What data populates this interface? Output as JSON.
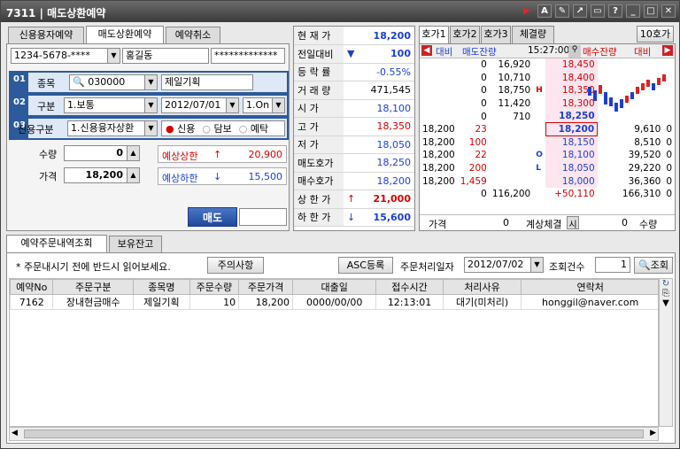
{
  "window": {
    "code": "7311",
    "title": "매도상환예약",
    "icons": [
      "play-icon",
      "a-icon",
      "edit-icon",
      "link-icon",
      "window-icon",
      "help-icon",
      "minimize-icon",
      "maximize-icon",
      "close-icon"
    ]
  },
  "tabs": [
    "신용용자예약",
    "매도상환예약",
    "예약취소"
  ],
  "account": {
    "number": "1234-5678-****",
    "name": "홍길동",
    "password": "*************"
  },
  "form": {
    "r1": {
      "num": "01",
      "label": "종목",
      "code": "030000",
      "name": "제일기획"
    },
    "r2": {
      "num": "02",
      "label": "구분",
      "type": "1.보통",
      "date": "2012/07/01",
      "option": "1.On"
    },
    "r3": {
      "num": "03",
      "label": "신용구분",
      "value": "1.신용융자상환",
      "radios": [
        "신용",
        "담보",
        "예탁"
      ]
    },
    "qty_label": "수량",
    "qty": "0",
    "price_label": "가격",
    "price": "18,200",
    "upper_label": "예상상한",
    "upper_arrow": "↑",
    "upper": "20,900",
    "lower_label": "예상하한",
    "lower_arrow": "↓",
    "lower": "15,500",
    "submit": "매도"
  },
  "quote": {
    "rows": [
      {
        "label": "현 재 가",
        "value": "18,200",
        "cls": "blue"
      },
      {
        "label": "전일대비",
        "arrow": "▼",
        "value": "100",
        "cls": "blue"
      },
      {
        "label": "등 락 률",
        "value": "-0.55%",
        "cls": "blue"
      },
      {
        "label": "거 래 량",
        "value": "471,545",
        "cls": ""
      },
      {
        "label": "시    가",
        "value": "18,100",
        "cls": "blue"
      },
      {
        "label": "고    가",
        "value": "18,350",
        "cls": "red"
      },
      {
        "label": "저    가",
        "value": "18,050",
        "cls": "blue"
      },
      {
        "label": "매도호가",
        "value": "18,250",
        "cls": "blue"
      },
      {
        "label": "매수호가",
        "value": "18,200",
        "cls": "blue"
      },
      {
        "label": "상 한 가",
        "arrow": "↑",
        "value": "21,000",
        "cls": "red"
      },
      {
        "label": "하 한 가",
        "arrow": "↓",
        "value": "15,600",
        "cls": "blue"
      }
    ]
  },
  "hoga": {
    "tabs": [
      "호가1",
      "호가2",
      "호가3",
      "체결량"
    ],
    "btn10": "10호가",
    "header": {
      "left_a": "대비",
      "left_b": "매도잔량",
      "time": "15:27:00",
      "right_a": "매수잔량",
      "right_b": "대비"
    },
    "asks": [
      {
        "d": "0",
        "q": "16,920",
        "p": "18,450",
        "m": ""
      },
      {
        "d": "0",
        "q": "10,710",
        "p": "18,400",
        "m": ""
      },
      {
        "d": "0",
        "q": "18,750",
        "p": "18,350",
        "m": "H"
      },
      {
        "d": "0",
        "q": "11,420",
        "p": "18,300",
        "m": ""
      },
      {
        "d": "0",
        "q": "710",
        "p": "18,250",
        "m": ""
      }
    ],
    "bids": [
      {
        "c": "18,200",
        "d": "23",
        "p": "18,200",
        "q": "9,610",
        "e": "0",
        "m": ""
      },
      {
        "c": "18,200",
        "d": "100",
        "p": "18,150",
        "q": "8,510",
        "e": "0",
        "m": ""
      },
      {
        "c": "18,200",
        "d": "22",
        "p": "18,100",
        "q": "39,520",
        "e": "0",
        "m": "O"
      },
      {
        "c": "18,200",
        "d": "200",
        "p": "18,050",
        "q": "29,220",
        "e": "0",
        "m": "L"
      },
      {
        "c": "18,200",
        "d": "1,459",
        "p": "18,000",
        "q": "36,360",
        "e": "0",
        "m": ""
      }
    ],
    "totals": {
      "d": "0",
      "sell": "116,200",
      "diff": "+50,110",
      "buy": "166,310",
      "e": "0"
    },
    "footer": {
      "price_label": "가격",
      "price": "0",
      "mid": "계상체결",
      "btn": "시",
      "qty": "0",
      "qty_label": "수량"
    }
  },
  "lower": {
    "tabs": [
      "예약주문내역조회",
      "보유잔고"
    ],
    "notice": "* 주문내시기 전에 반드시 읽어보세요.",
    "notice_btn": "주의사항",
    "asc_btn": "ASC등록",
    "date_label": "주문처리일자",
    "date": "2012/07/02",
    "count_label": "조회건수",
    "count": "1",
    "search_btn": "조회",
    "columns": [
      "예약No",
      "주문구분",
      "종목명",
      "주문수량",
      "주문가격",
      "대출일",
      "접수시간",
      "처리사유",
      "연락처"
    ],
    "rows": [
      [
        "7162",
        "장내현금매수",
        "제일기획",
        "10",
        "18,200",
        "0000/00/00",
        "12:13:01",
        "대기(미처리)",
        "honggil@naver.com"
      ]
    ]
  }
}
